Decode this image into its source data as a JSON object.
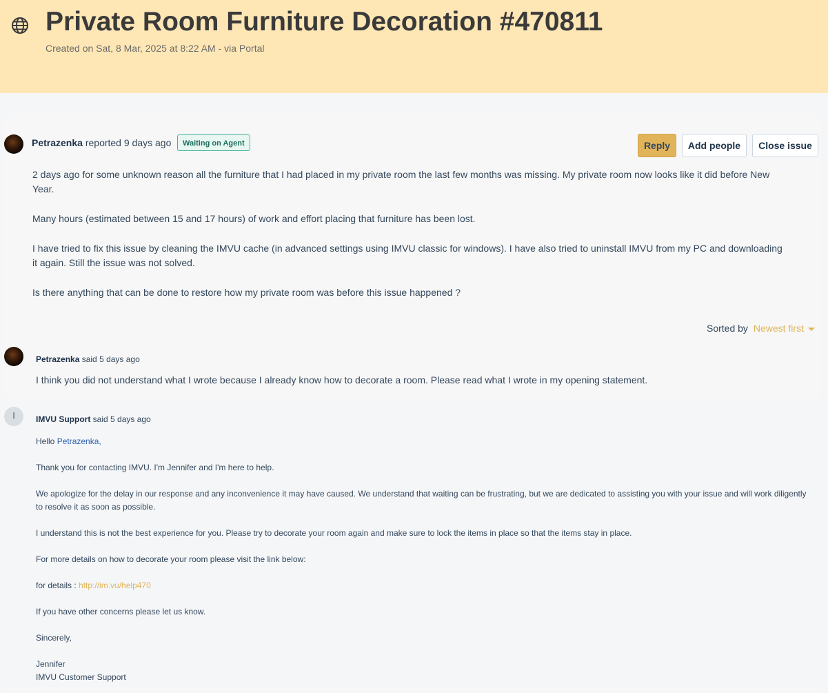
{
  "header": {
    "icon": "globe-icon",
    "title": "Private Room Furniture Decoration #470811",
    "subtitle": "Created on Sat, 8 Mar, 2025 at 8:22 AM - via Portal"
  },
  "issue": {
    "reporter": "Petrazenka",
    "reported_text": "reported 9 days ago",
    "status": "Waiting on Agent",
    "actions": {
      "reply": "Reply",
      "add_people": "Add people",
      "close_issue": "Close issue"
    },
    "paragraphs": [
      "2 days ago for some unknown reason all the furniture that I had placed in my private room the last few months was missing. My private room now looks like it did before New Year.",
      "Many hours (estimated between 15 and 17 hours) of work and effort placing that furniture has been lost.",
      "I have tried to fix this issue by cleaning the IMVU cache (in advanced settings using IMVU classic for windows). I have also tried to uninstall IMVU from my PC and downloading it again.  Still the issue was not solved.",
      "Is there anything that can be done to restore how my private room was before this issue happened ?"
    ]
  },
  "sort": {
    "label": "Sorted by",
    "value": "Newest first"
  },
  "comments": [
    {
      "author": "Petrazenka",
      "meta": "said 5 days ago",
      "body": "I think you did not understand what I wrote because I already know how to decorate a room. Please read what I wrote in my opening statement."
    },
    {
      "author": "IMVU Support",
      "avatar_letter": "I",
      "meta": "said 5 days ago",
      "greeting_prefix": "Hello ",
      "greeting_name": "Petrazenka",
      "greeting_suffix": ",",
      "paragraphs": [
        "Thank you for contacting IMVU. I'm Jennifer and I'm here to help.",
        "We apologize for the delay in our response and any inconvenience it may have caused. We understand that waiting can be frustrating, but we are dedicated to assisting you with your issue and will work diligently to resolve it as soon as possible.",
        "I understand this is not the best experience for you. Please try to decorate your room again and make sure to lock the items in place so that the items stay in place.",
        "For more details on how to decorate your room please visit the link below:"
      ],
      "details_label": "for details : ",
      "details_link": "http://im.vu/help470",
      "closing": "If you have other concerns please let us know.",
      "signoff": "Sincerely,",
      "signature_name": "Jennifer",
      "signature_team": "IMVU Customer Support"
    }
  ],
  "colors": {
    "header_bg": "#ffe7b5",
    "accent": "#e2b45a",
    "badge_border": "#49b29b",
    "link": "#2f63b0"
  }
}
